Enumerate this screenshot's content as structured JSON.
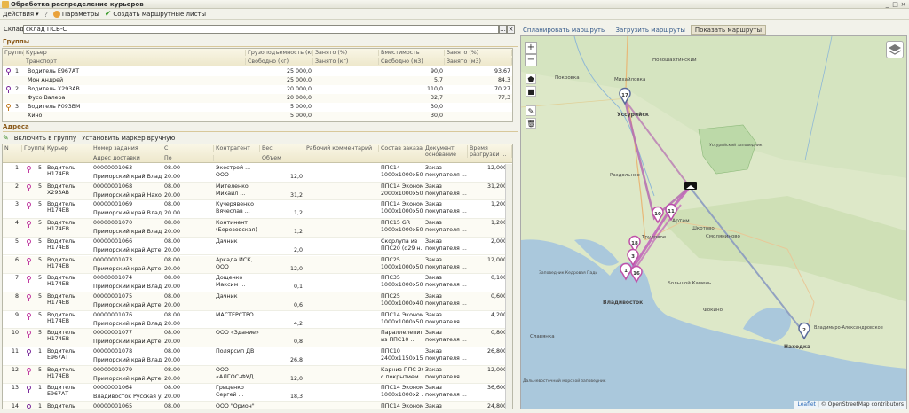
{
  "window": {
    "title": "Обработка распределение курьеров",
    "controls": [
      "_",
      "□",
      "×"
    ]
  },
  "toolbar": {
    "actions": "Действия",
    "params": "Параметры",
    "create_sheets": "Создать маршрутные листы"
  },
  "warehouse": {
    "label": "Склад:",
    "value": "склад ПСБ-С",
    "select_button": "...",
    "clear_button": "×"
  },
  "map_tabs": [
    "Спланировать маршруты",
    "Загрузить маршруты",
    "Показать маршруты"
  ],
  "groups": {
    "title": "Группы",
    "headers_top": [
      "Группа",
      "Курьер",
      "Грузоподъемность (кг)",
      "Занято (%)",
      "Вместимость",
      "Занято (%)"
    ],
    "headers_bottom": [
      "Транспорт",
      "Свободно (кг)",
      "Занято (кг)",
      "Свободно (м3)",
      "Занято (м3)"
    ],
    "rows": [
      {
        "num": "1",
        "courier": "Водитель Е967АТ",
        "capacity": "25 000,0",
        "volume": "90,0",
        "pct": "93,67",
        "pin_color": "#7a2a9a"
      },
      {
        "num": "",
        "courier": "Мон Андрей",
        "capacity": "25 000,0",
        "volume": "5,7",
        "pct": "84,3",
        "pin_color": ""
      },
      {
        "num": "2",
        "courier": "Водитель Х293АВ",
        "capacity": "20 000,0",
        "volume": "110,0",
        "pct": "70,27",
        "pin_color": "#7a2a9a"
      },
      {
        "num": "",
        "courier": "Фусо Валера",
        "capacity": "20 000,0",
        "volume": "32,7",
        "pct": "77,3",
        "pin_color": ""
      },
      {
        "num": "3",
        "courier": "Водитель Р093ВМ",
        "capacity": "5 000,0",
        "volume": "30,0",
        "pct": "",
        "pin_color": "#c07a20"
      },
      {
        "num": "",
        "courier": "Хино",
        "capacity": "5 000,0",
        "volume": "30,0",
        "pct": "",
        "pin_color": ""
      }
    ]
  },
  "addresses": {
    "title": "Адреса",
    "tools": {
      "include": "Включить в группу",
      "set_marker": "Установить маркер вручную"
    },
    "headers_top": [
      "N",
      "Группа",
      "Курьер",
      "Номер задания",
      "С",
      "Контрагент",
      "Вес",
      "Рабочий комментарий",
      "Состав заказа",
      "Документ основание",
      "Время разгрузки ..."
    ],
    "headers_bottom": [
      "Адрес доставки",
      "По",
      "Объем"
    ],
    "rows": [
      {
        "n": "1",
        "grp": "5",
        "courier": "Водитель Н174ЕВ",
        "task": "00000001063",
        "addr": "Приморский край Владив...",
        "from": "08.00",
        "to": "20.00",
        "contr": "Экострой ...",
        "contr2": "ООО",
        "weight": "",
        "vol": "12,0",
        "order": "ППС14",
        "order2": "1000х1000х50 ...",
        "doc": "Заказ",
        "doc2": "покупателя ...",
        "time": "12,000"
      },
      {
        "n": "2",
        "grp": "5",
        "courier": "Водитель Х293АВ",
        "task": "00000001068",
        "addr": "Приморский край Находк...",
        "from": "08.00",
        "to": "20.00",
        "contr": "Мителенко",
        "contr2": "Михаил ...",
        "weight": "",
        "vol": "31,2",
        "order": "ППС14 Эконом",
        "order2": "2000х1000х50 ...",
        "doc": "Заказ",
        "doc2": "покупателя ...",
        "time": "31,200"
      },
      {
        "n": "3",
        "grp": "5",
        "courier": "Водитель Н174ЕВ",
        "task": "00000001069",
        "addr": "Приморский край Владив...",
        "from": "08.00",
        "to": "20.00",
        "contr": "Кучерявенко",
        "contr2": "Вячеслав ...",
        "weight": "",
        "vol": "1,2",
        "order": "ППС14 Эконом",
        "order2": "1000х1000х50 ...",
        "doc": "Заказ",
        "doc2": "покупателя ...",
        "time": "1,200"
      },
      {
        "n": "4",
        "grp": "5",
        "courier": "Водитель Н174ЕВ",
        "task": "00000001070",
        "addr": "Приморский край Владив...",
        "from": "08.00",
        "to": "20.00",
        "contr": "Континент",
        "contr2": "(Березовская)",
        "weight": "",
        "vol": "1,2",
        "order": "ППС15 GR",
        "order2": "1000х1000х50 ...",
        "doc": "Заказ",
        "doc2": "покупателя ...",
        "time": "1,200"
      },
      {
        "n": "5",
        "grp": "5",
        "courier": "Водитель Н174ЕВ",
        "task": "00000001066",
        "addr": "Приморский край Артем ...",
        "from": "08.00",
        "to": "20.00",
        "contr": "Дачник",
        "contr2": "",
        "weight": "",
        "vol": "2,0",
        "order": "Скорлупа из",
        "order2": "ППС20 (d29 н...",
        "doc": "Заказ",
        "doc2": "покупателя ...",
        "time": "2,000"
      },
      {
        "n": "6",
        "grp": "5",
        "courier": "Водитель Н174ЕВ",
        "task": "00000001073",
        "addr": "Приморский край Артем ...",
        "from": "08.00",
        "to": "20.00",
        "contr": "Аркада ИСК,",
        "contr2": "ООО",
        "weight": "",
        "vol": "12,0",
        "order": "ППС25",
        "order2": "1000х1000х50 ...",
        "doc": "Заказ",
        "doc2": "покупателя ...",
        "time": "12,000"
      },
      {
        "n": "7",
        "grp": "5",
        "courier": "Водитель Н174ЕВ",
        "task": "00000001074",
        "addr": "Приморский край Владив...",
        "from": "08.00",
        "to": "20.00",
        "contr": "Дощенко",
        "contr2": "Максим ...",
        "weight": "",
        "vol": "0,1",
        "order": "ППС35",
        "order2": "1000х1000х50 ...",
        "doc": "Заказ",
        "doc2": "покупателя ...",
        "time": "0,100"
      },
      {
        "n": "8",
        "grp": "5",
        "courier": "Водитель Н174ЕВ",
        "task": "00000001075",
        "addr": "Приморский край Артем ...",
        "from": "08.00",
        "to": "20.00",
        "contr": "Дачник",
        "contr2": "",
        "weight": "",
        "vol": "0,6",
        "order": "ППС25",
        "order2": "1000х1000х40 ...",
        "doc": "Заказ",
        "doc2": "покупателя ...",
        "time": "0,600"
      },
      {
        "n": "9",
        "grp": "5",
        "courier": "Водитель Н174ЕВ",
        "task": "00000001076",
        "addr": "Приморский край Владив...",
        "from": "08.00",
        "to": "20.00",
        "contr": "МАСТЕРСТРО...",
        "contr2": "",
        "weight": "",
        "vol": "4,2",
        "order": "ППС14 Эконом",
        "order2": "1000х1000х50 ...",
        "doc": "Заказ",
        "doc2": "покупателя ...",
        "time": "4,200"
      },
      {
        "n": "10",
        "grp": "5",
        "courier": "Водитель Н174ЕВ",
        "task": "00000001077",
        "addr": "Приморский край Артем ...",
        "from": "08.00",
        "to": "20.00",
        "contr": "ООО «Здание»",
        "contr2": "",
        "weight": "",
        "vol": "0,8",
        "order": "Параллелепипед",
        "order2": "из ППС10 ...",
        "doc": "Заказ",
        "doc2": "покупателя ...",
        "time": "0,800"
      },
      {
        "n": "11",
        "grp": "1",
        "courier": "Водитель Е967АТ",
        "task": "00000001078",
        "addr": "Приморский край Владив...",
        "from": "08.00",
        "to": "20.00",
        "contr": "Полярсип ДВ",
        "contr2": "",
        "weight": "",
        "vol": "26,8",
        "order": "ППС10",
        "order2": "2400х1150х15 ...",
        "doc": "Заказ",
        "doc2": "покупателя ...",
        "time": "26,800"
      },
      {
        "n": "12",
        "grp": "5",
        "courier": "Водитель Н174ЕВ",
        "task": "00000001079",
        "addr": "Приморский край Артем ...",
        "from": "08.00",
        "to": "20.00",
        "contr": "ООО",
        "contr2": "«АЛГОС-ФУД ...",
        "weight": "",
        "vol": "12,0",
        "order": "Карниз ППС 20,",
        "order2": "с покрытием ...",
        "doc": "Заказ",
        "doc2": "покупателя ...",
        "time": "12,000"
      },
      {
        "n": "13",
        "grp": "1",
        "courier": "Водитель Е967АТ",
        "task": "00000001064",
        "addr": "Владивосток Русская ул",
        "from": "08.00",
        "to": "20.00",
        "contr": "Гриценко",
        "contr2": "Сергей ...",
        "weight": "",
        "vol": "18,3",
        "order": "ППС14 Эконом",
        "order2": "1000х1000х2 ...",
        "doc": "Заказ",
        "doc2": "покупателя ...",
        "time": "36,600"
      },
      {
        "n": "14",
        "grp": "1",
        "courier": "Водитель Е967АТ",
        "task": "00000001065",
        "addr": "",
        "from": "08.00",
        "to": "",
        "contr": "ООО \"Орион\"",
        "contr2": "",
        "weight": "",
        "vol": "",
        "order": "ППС14 Эконом",
        "order2": "",
        "doc": "Заказ",
        "doc2": "",
        "time": "24,800"
      }
    ]
  },
  "map": {
    "zoom_in": "+",
    "zoom_out": "−",
    "markers": [
      "17",
      "11",
      "10",
      "18",
      "3",
      "1",
      "16",
      "2"
    ],
    "places": [
      "Михайловка",
      "Новошахтинский",
      "Покровка",
      "Уссурийск",
      "Раздольное",
      "Артем",
      "Трудовое",
      "Шкотово",
      "Смоляниново",
      "Владивосток",
      "Большой Камень",
      "Фокино",
      "Находка",
      "Славянка",
      "Уссурийский заповедник",
      "Владимиро-Александровское",
      "Дальневосточный морской заповедник",
      "Заповедник Кедровая Падь"
    ],
    "attribution_leaflet": "Leaflet",
    "attribution_osm": "© OpenStreetMap contributors"
  }
}
